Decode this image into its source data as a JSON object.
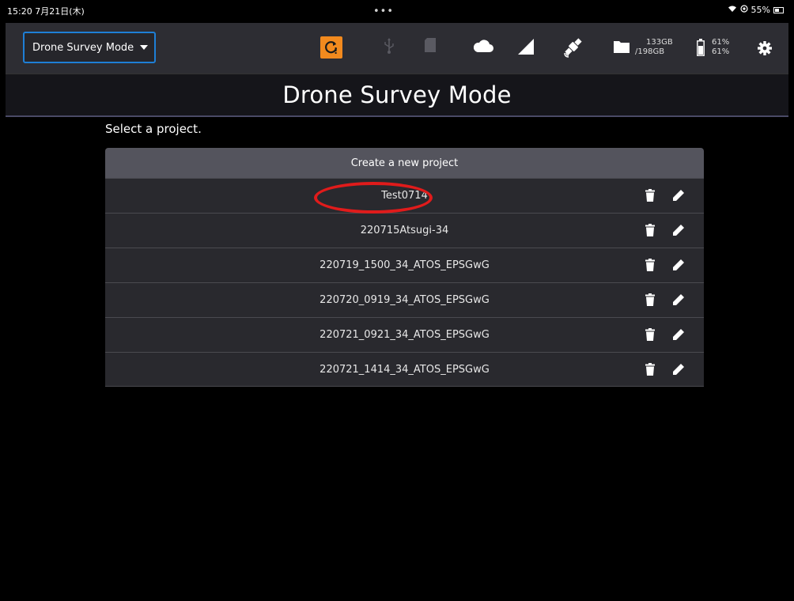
{
  "status_bar": {
    "time": "15:20 7月21日(木)",
    "dots": "•••",
    "battery_pct": "55%"
  },
  "toolbar": {
    "mode_select_value": "Drone Survey Mode",
    "storage_used": "133GB",
    "storage_total": "/198GB",
    "battery_top": "61%",
    "battery_bottom": "61%",
    "icons": [
      "sync-alert-icon",
      "usb-icon",
      "sd-card-icon",
      "cloud-icon",
      "signal-icon",
      "satellite-icon",
      "folder-icon",
      "battery-icon",
      "gear-icon"
    ],
    "accent_color": "#f28a1e"
  },
  "header": {
    "title": "Drone Survey Mode"
  },
  "main": {
    "instruction": "Select a project.",
    "create_label": "Create a new project",
    "projects": [
      {
        "name": "Test0714"
      },
      {
        "name": "220715Atsugi-34"
      },
      {
        "name": "220719_1500_34_ATOS_EPSGwG"
      },
      {
        "name": "220720_0919_34_ATOS_EPSGwG"
      },
      {
        "name": "220721_0921_34_ATOS_EPSGwG"
      },
      {
        "name": "220721_1414_34_ATOS_EPSGwG"
      }
    ],
    "row_icons": [
      "trash-icon",
      "pencil-icon"
    ]
  }
}
